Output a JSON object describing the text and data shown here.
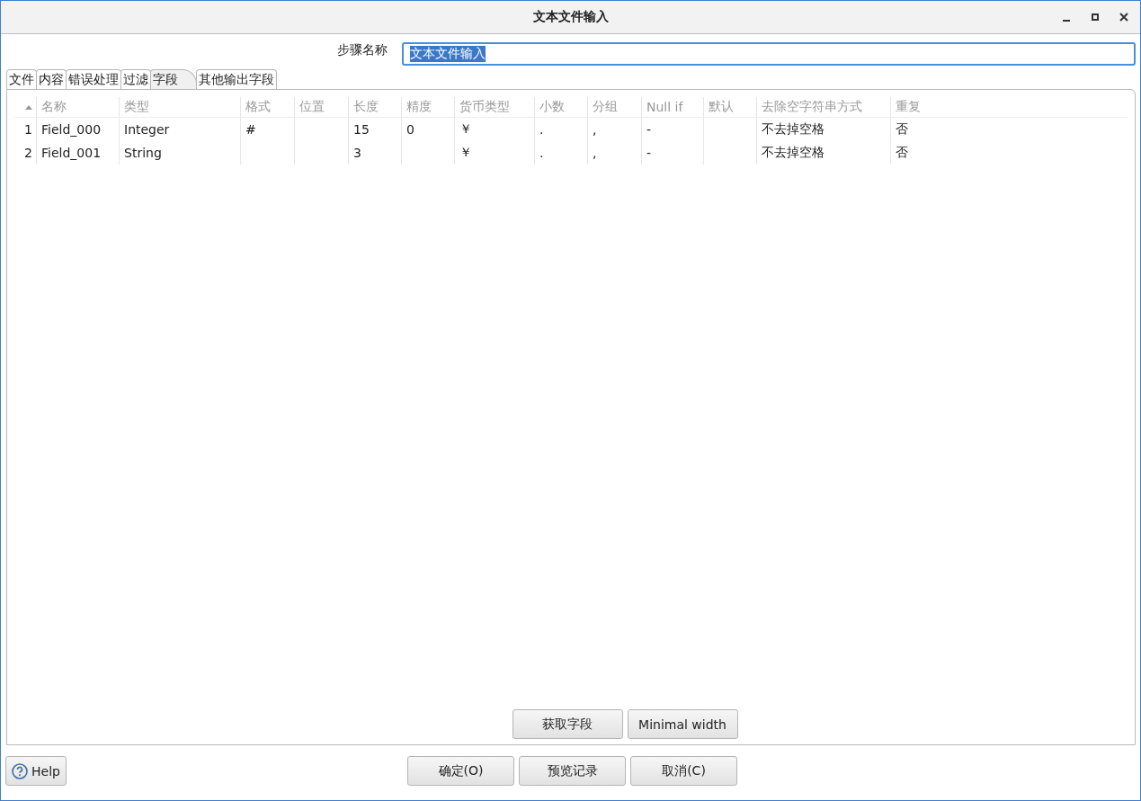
{
  "window": {
    "title": "文本文件输入"
  },
  "step_name": {
    "label": "步骤名称",
    "value": "文本文件输入"
  },
  "tabs": [
    {
      "label": "文件",
      "selected": false
    },
    {
      "label": "内容",
      "selected": false
    },
    {
      "label": "错误处理",
      "selected": false
    },
    {
      "label": "过滤",
      "selected": false
    },
    {
      "label": "字段",
      "selected": true
    },
    {
      "label": "其他输出字段",
      "selected": false
    }
  ],
  "table": {
    "columns": [
      "名称",
      "类型",
      "格式",
      "位置",
      "长度",
      "精度",
      "货币类型",
      "小数",
      "分组",
      "Null if",
      "默认",
      "去除空字符串方式",
      "重复"
    ],
    "rows": [
      {
        "number": "1",
        "cells": [
          "Field_000",
          "Integer",
          "#",
          "",
          "15",
          "0",
          "￥",
          ".",
          ",",
          "-",
          "",
          "不去掉空格",
          "否"
        ]
      },
      {
        "number": "2",
        "cells": [
          "Field_001",
          "String",
          "",
          "",
          "3",
          "",
          "￥",
          ".",
          ",",
          "-",
          "",
          "不去掉空格",
          "否"
        ]
      }
    ]
  },
  "table_buttons": [
    "获取字段",
    "Minimal width"
  ],
  "help_button": "Help",
  "dialog_buttons": [
    "确定(O)",
    "预览记录",
    "取消(C)"
  ]
}
